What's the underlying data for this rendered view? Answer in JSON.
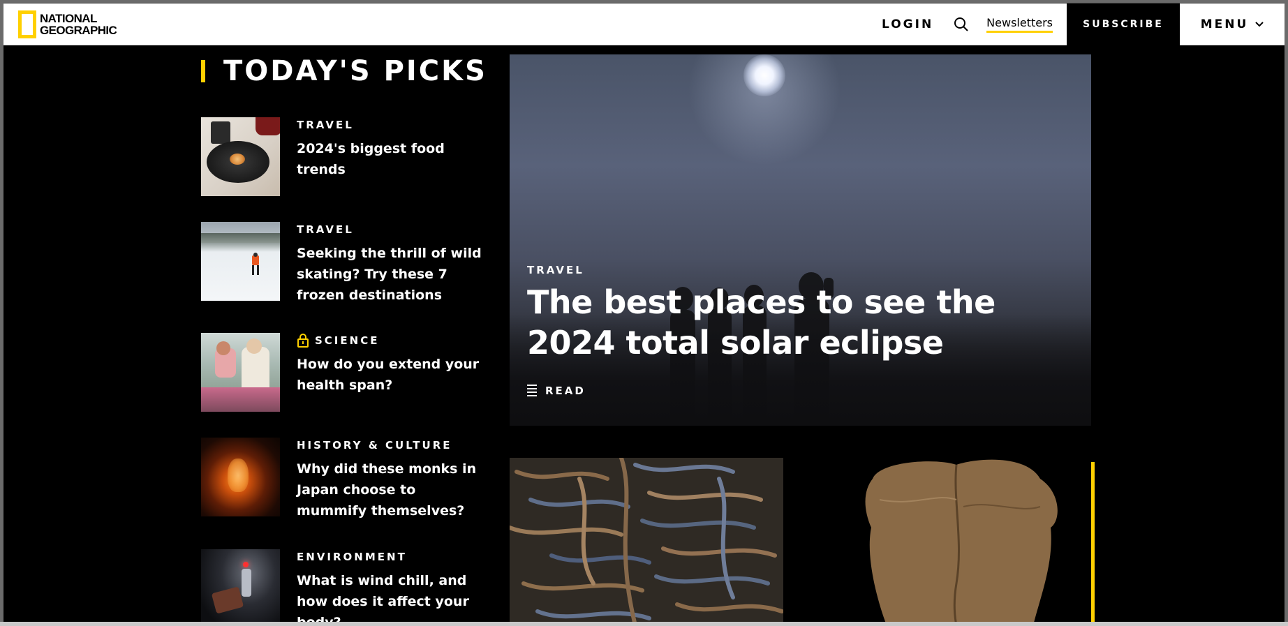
{
  "header": {
    "logo_line1": "NATIONAL",
    "logo_line2": "GEOGRAPHIC",
    "login": "LOGIN",
    "newsletters": "Newsletters",
    "subscribe": "SUBSCRIBE",
    "menu": "MENU"
  },
  "picks": {
    "title": "TODAY'S PICKS",
    "items": [
      {
        "category": "TRAVEL",
        "headline": "2024's biggest food trends",
        "locked": false
      },
      {
        "category": "TRAVEL",
        "headline": "Seeking the thrill of wild skating? Try these 7 frozen destinations",
        "locked": false
      },
      {
        "category": "SCIENCE",
        "headline": "How do you extend your health span?",
        "locked": true
      },
      {
        "category": "HISTORY & CULTURE",
        "headline": "Why did these monks in Japan choose to mummify themselves?",
        "locked": false
      },
      {
        "category": "ENVIRONMENT",
        "headline": "What is wind chill, and how does it affect your body?",
        "locked": false
      }
    ]
  },
  "hero": {
    "category": "TRAVEL",
    "title": "The best places to see the 2024 total solar eclipse",
    "read": "READ"
  },
  "colors": {
    "accent": "#ffd000",
    "background": "#000000",
    "header_bg": "#ffffff"
  },
  "icons": {
    "search": "search-icon",
    "menu_chevron": "chevron-down-icon",
    "lock": "lock-icon",
    "read": "text-lines-icon"
  }
}
